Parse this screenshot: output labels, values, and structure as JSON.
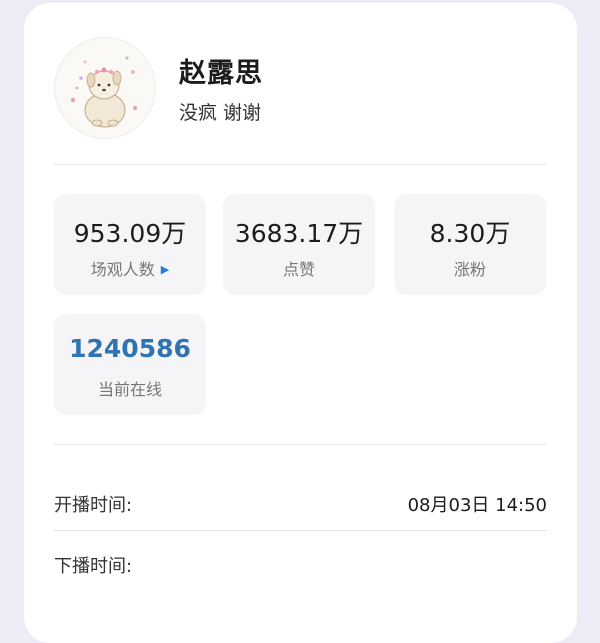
{
  "profile": {
    "name": "赵露思",
    "bio": "没疯 谢谢",
    "avatar_icon": "cartoon-puppy-avatar"
  },
  "stats": [
    {
      "value": "953.09万",
      "label": "场观人数",
      "icon": "play-triangle-icon",
      "accent": "#2b7fd0"
    },
    {
      "value": "3683.17万",
      "label": "点赞"
    },
    {
      "value": "8.30万",
      "label": "涨粉"
    },
    {
      "value": "1240586",
      "label": "当前在线",
      "color": "#2f73b0"
    }
  ],
  "info": {
    "start_label": "开播时间:",
    "start_value": "08月03日 14:50",
    "end_label": "下播时间:",
    "end_value": ""
  },
  "colors": {
    "background": "#ecebf6",
    "card": "#ffffff",
    "tile": "#f5f5f7",
    "accent": "#2f73b0"
  }
}
